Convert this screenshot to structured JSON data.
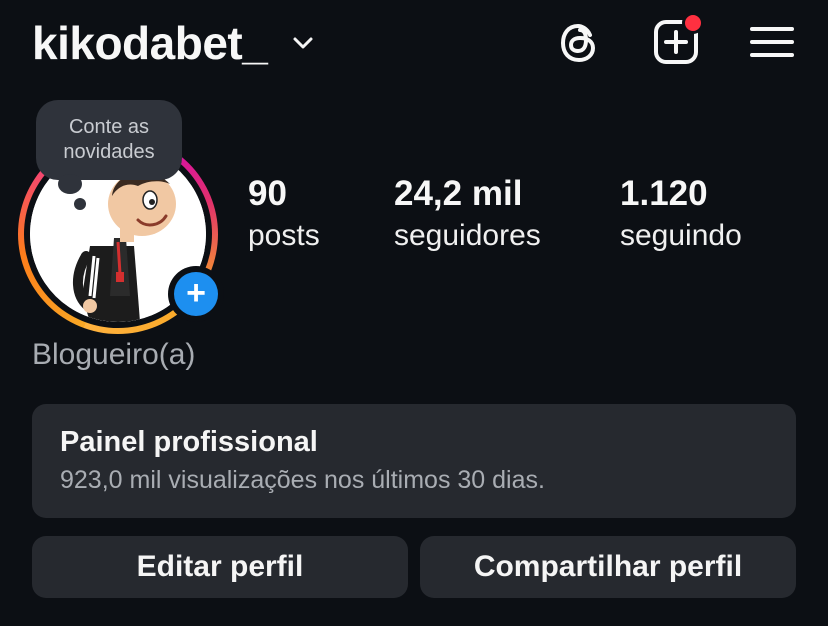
{
  "header": {
    "username": "kikodabet_",
    "icons": {
      "account_switch": "chevron-down-icon",
      "threads": "threads-icon",
      "create": "create-plus-icon",
      "menu": "hamburger-menu-icon"
    },
    "has_notification": true
  },
  "profile": {
    "tooltip": {
      "line1": "Conte as",
      "line2": "novidades"
    },
    "add_story_symbol": "+",
    "stats": {
      "posts": {
        "value": "90",
        "label": "posts"
      },
      "followers": {
        "value": "24,2 mil",
        "label": "seguidores"
      },
      "following": {
        "value": "1.120",
        "label": "seguindo"
      }
    },
    "category": "Blogueiro(a)"
  },
  "professional_panel": {
    "title": "Painel profissional",
    "subtitle": "923,0 mil visualizações nos últimos 30 dias."
  },
  "actions": {
    "edit_label": "Editar perfil",
    "share_label": "Compartilhar perfil"
  },
  "colors": {
    "background": "#0c0f14",
    "panel": "#26292f",
    "accent_blue": "#1d8ff0",
    "notification_red": "#ff3040"
  }
}
